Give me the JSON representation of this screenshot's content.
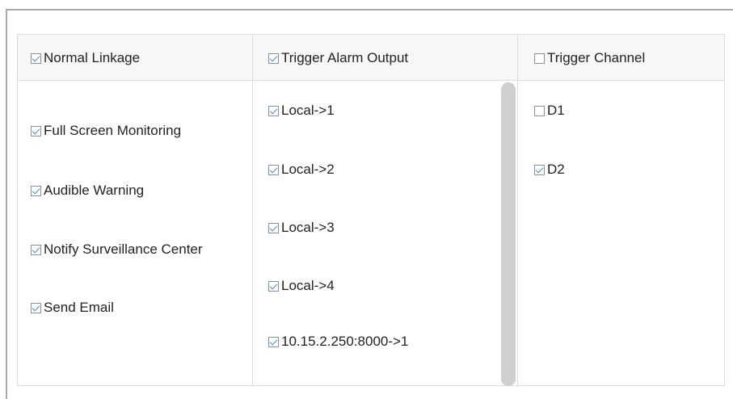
{
  "normal_linkage": {
    "header": {
      "label": "Normal Linkage",
      "checked": true
    },
    "items": [
      {
        "label": "Full Screen Monitoring",
        "checked": true
      },
      {
        "label": "Audible Warning",
        "checked": true
      },
      {
        "label": "Notify Surveillance Center",
        "checked": true
      },
      {
        "label": "Send Email",
        "checked": true
      }
    ]
  },
  "trigger_alarm_output": {
    "header": {
      "label": "Trigger Alarm Output",
      "checked": true
    },
    "items": [
      {
        "label": "Local->1",
        "checked": true
      },
      {
        "label": "Local->2",
        "checked": true
      },
      {
        "label": "Local->3",
        "checked": true
      },
      {
        "label": "Local->4",
        "checked": true
      },
      {
        "label": "10.15.2.250:8000->1",
        "checked": true
      }
    ]
  },
  "trigger_channel": {
    "header": {
      "label": "Trigger Channel",
      "checked": false
    },
    "items": [
      {
        "label": "D1",
        "checked": false
      },
      {
        "label": "D2",
        "checked": true
      }
    ]
  }
}
